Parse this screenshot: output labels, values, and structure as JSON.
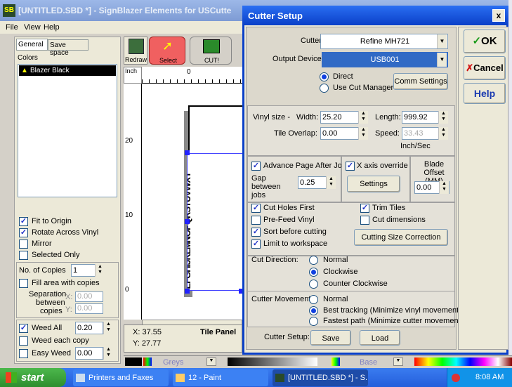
{
  "app": {
    "title": "[UNTITLED.SBD *] - SignBlazer Elements for USCutte",
    "logo": "SB",
    "menu": [
      "File",
      "View",
      "Help"
    ]
  },
  "left": {
    "tabs": [
      "General",
      "Save space"
    ],
    "colors_label": "Colors",
    "color_item": "Blazer Black",
    "checks": [
      {
        "label": "Fit to Origin",
        "checked": true
      },
      {
        "label": "Rotate Across Vinyl",
        "checked": true
      },
      {
        "label": "Mirror",
        "checked": false
      },
      {
        "label": "Selected Only",
        "checked": false
      }
    ],
    "copies_label": "No. of Copies",
    "copies_value": "1",
    "fill_label": "Fill area with copies",
    "sep_label": "Separation",
    "between_label": "between",
    "copies_word": "copies",
    "x_label": "X:",
    "y_label": "Y:",
    "sep_x": "0.00",
    "sep_y": "0.00",
    "weed_all": "Weed All",
    "weed_all_value": "0.20",
    "weed_each": "Weed each copy",
    "easy_weed": "Easy Weed",
    "easy_weed_value": "0.00"
  },
  "toolbar": {
    "redraw": "Redraw",
    "select": "Select",
    "cut": "CUT!",
    "inch": "Inch",
    "ruler_20": "20",
    "ruler_10": "10",
    "ruler_0": "0",
    "ruler_top_0": "0"
  },
  "status": {
    "x": "X: 37.55",
    "y": "Y: 27.77",
    "tile_panel": "Tile Panel"
  },
  "palette": {
    "greys": "Greys",
    "base": "Base"
  },
  "dialog": {
    "title": "Cutter Setup",
    "cutter_label": "Cutter:",
    "cutter_value": "Refine MH721",
    "output_label": "Output Device:",
    "output_value": "USB001",
    "direct": "Direct",
    "use_cut_manager": "Use Cut Manager",
    "comm_settings": "Comm Settings",
    "vinyl_size": "Vinyl size -",
    "width_label": "Width:",
    "width_value": "25.20",
    "length_label": "Length:",
    "length_value": "999.92",
    "tile_overlap": "Tile Overlap:",
    "tile_value": "0.00",
    "speed_label": "Speed:",
    "speed_value": "33.43",
    "speed_unit": "Inch/Sec",
    "advance_page": "Advance Page After Job",
    "gap_label": "Gap between jobs",
    "gap_value": "0.25",
    "x_axis": "X axis override",
    "settings": "Settings",
    "blade_offset": "Blade Offset (MM)",
    "blade_value": "0.00",
    "cut_holes": "Cut Holes First",
    "pre_feed": "Pre-Feed Vinyl",
    "sort_before": "Sort before cutting",
    "limit_ws": "Limit to workspace",
    "trim_tiles": "Trim Tiles",
    "cut_dims": "Cut dimensions",
    "cut_size_corr": "Cutting Size Correction",
    "cut_direction": "Cut Direction:",
    "dir_normal": "Normal",
    "dir_clockwise": "Clockwise",
    "dir_ccw": "Counter Clockwise",
    "cutter_movement": "Cutter Movement:",
    "mv_normal": "Normal",
    "mv_best": "Best tracking (Minimize vinyl movement)",
    "mv_fast": "Fastest path (Minimize cutter movement)",
    "cutter_setup": "Cutter Setup:",
    "save": "Save",
    "load": "Load",
    "ok": "OK",
    "cancel": "Cancel",
    "help": "Help",
    "close": "x"
  },
  "taskbar": {
    "start": "start",
    "items": [
      "Printers and Faxes",
      "12 - Paint",
      "[UNTITLED.SBD *] - S..."
    ],
    "clock": "8:08 AM"
  },
  "vinyl_text": "ABCDEFGHIJKLMNOPQRSTUVWXYZ"
}
